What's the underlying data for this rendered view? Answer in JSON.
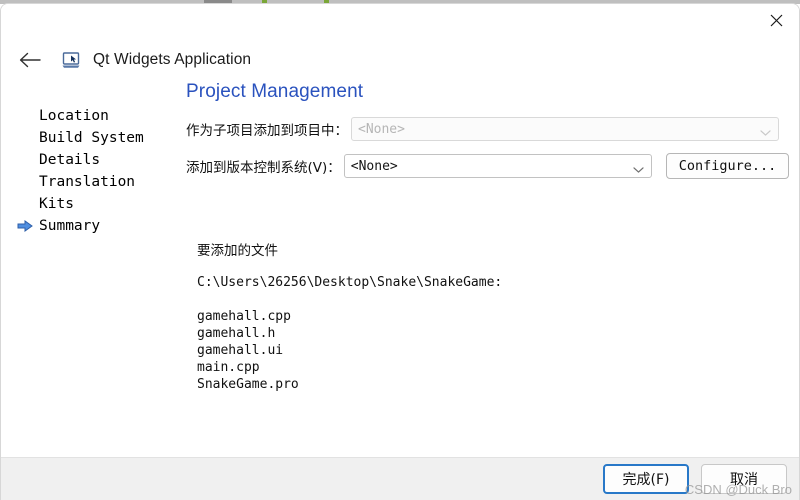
{
  "window": {
    "app_title": "Qt Widgets Application",
    "app_icon": "qt-widgets-app-icon",
    "back_icon": "back-arrow-icon",
    "close_icon": "close-icon"
  },
  "sidebar": {
    "items": [
      {
        "label": "Location",
        "current": false
      },
      {
        "label": "Build System",
        "current": false
      },
      {
        "label": "Details",
        "current": false
      },
      {
        "label": "Translation",
        "current": false
      },
      {
        "label": "Kits",
        "current": false
      },
      {
        "label": "Summary",
        "current": true
      }
    ],
    "current_marker_icon": "right-arrow-icon"
  },
  "main": {
    "heading": "Project Management",
    "heading_color": "#2a52be",
    "form": {
      "subproject": {
        "label": "作为子项目添加到项目中：",
        "value": "<None>",
        "enabled": false,
        "chevron_icon": "chevron-down-icon"
      },
      "vcs": {
        "label": "添加到版本控制系统(V)：",
        "value": "<None>",
        "enabled": true,
        "chevron_icon": "chevron-down-icon",
        "configure_label": "Configure..."
      }
    },
    "files": {
      "title": "要添加的文件",
      "path": "C:\\Users\\26256\\Desktop\\Snake\\SnakeGame:",
      "list": [
        "gamehall.cpp",
        "gamehall.h",
        "gamehall.ui",
        "main.cpp",
        "SnakeGame.pro"
      ]
    }
  },
  "footer": {
    "finish_label": "完成(F)",
    "cancel_label": "取消",
    "accent_color": "#2878c8"
  },
  "watermark": {
    "text": "CSDN @Duck Bro"
  }
}
